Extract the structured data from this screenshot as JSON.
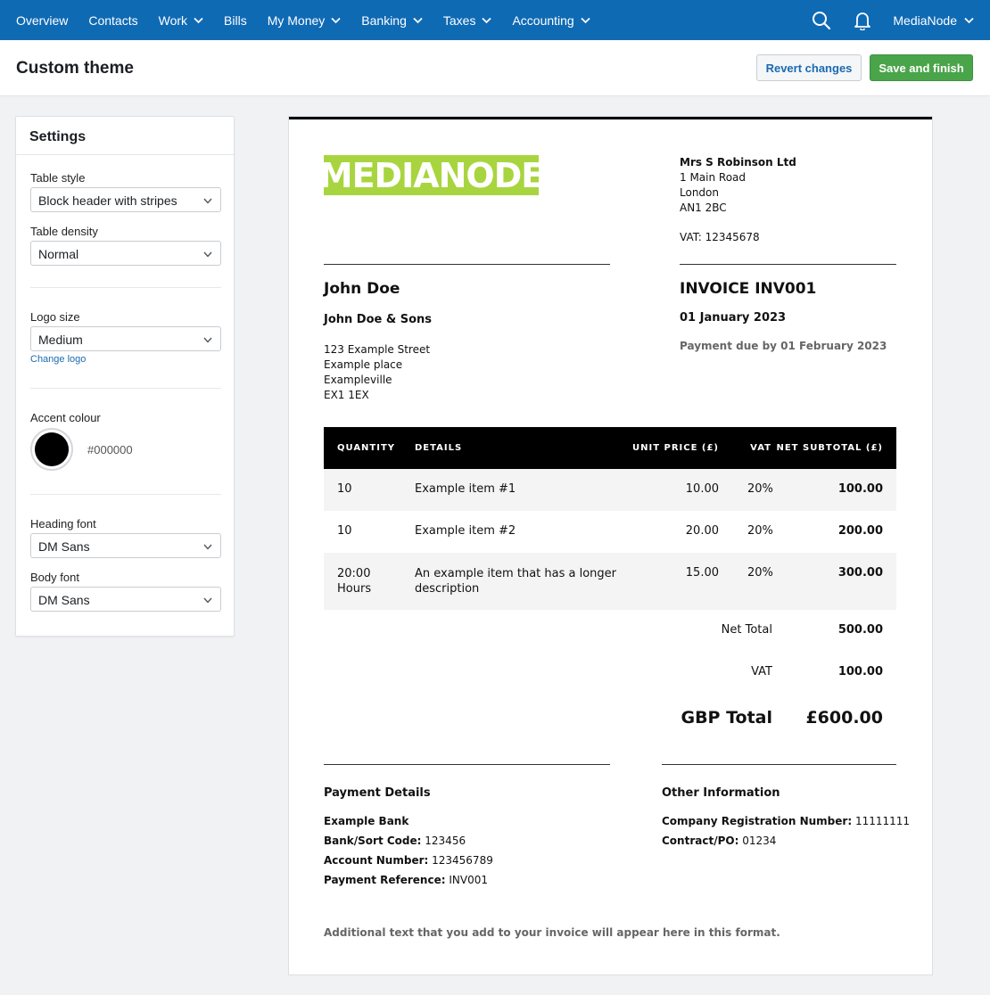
{
  "nav": {
    "items": [
      {
        "label": "Overview",
        "dropdown": false
      },
      {
        "label": "Contacts",
        "dropdown": false
      },
      {
        "label": "Work",
        "dropdown": true
      },
      {
        "label": "Bills",
        "dropdown": false
      },
      {
        "label": "My Money",
        "dropdown": true
      },
      {
        "label": "Banking",
        "dropdown": true
      },
      {
        "label": "Taxes",
        "dropdown": true
      },
      {
        "label": "Accounting",
        "dropdown": true
      }
    ],
    "icons": [
      "search-icon",
      "bell-icon"
    ],
    "org_name": "MediaNode"
  },
  "page": {
    "title": "Custom theme",
    "revert_label": "Revert changes",
    "save_label": "Save and finish"
  },
  "settings": {
    "title": "Settings",
    "table_style_label": "Table style",
    "table_style_value": "Block header with stripes",
    "table_density_label": "Table density",
    "table_density_value": "Normal",
    "logo_size_label": "Logo size",
    "logo_size_value": "Medium",
    "change_logo_label": "Change logo",
    "accent_label": "Accent colour",
    "accent_hex": "#000000",
    "heading_font_label": "Heading font",
    "heading_font_value": "DM Sans",
    "body_font_label": "Body font",
    "body_font_value": "DM Sans"
  },
  "invoice": {
    "logo_text": "MEDIANODE",
    "logo_color": "#a8d53f",
    "sender": {
      "name": "Mrs S Robinson Ltd",
      "lines": [
        "1 Main Road",
        "London",
        "AN1 2BC"
      ],
      "vat": "VAT: 12345678"
    },
    "client": {
      "name": "John Doe",
      "company": "John Doe & Sons",
      "lines": [
        "123 Example Street",
        "Example place",
        "Exampleville",
        "EX1 1EX"
      ]
    },
    "number": "INVOICE INV001",
    "date": "01 January 2023",
    "due": "Payment due by 01 February 2023",
    "table": {
      "headers": [
        "QUANTITY",
        "DETAILS",
        "UNIT PRICE (£)",
        "VAT",
        "NET SUBTOTAL (£)"
      ],
      "rows": [
        {
          "qty": "10",
          "details": "Example item #1",
          "price": "10.00",
          "vat": "20%",
          "subtotal": "100.00"
        },
        {
          "qty": "10",
          "details": "Example item #2",
          "price": "20.00",
          "vat": "20%",
          "subtotal": "200.00"
        },
        {
          "qty": "20:00 Hours",
          "details": "An example item that has a longer description",
          "price": "15.00",
          "vat": "20%",
          "subtotal": "300.00"
        }
      ]
    },
    "totals": {
      "net_label": "Net Total",
      "net_value": "500.00",
      "vat_label": "VAT",
      "vat_value": "100.00",
      "gbp_label": "GBP Total",
      "gbp_value": "£600.00"
    },
    "payment": {
      "title": "Payment Details",
      "bank": "Example Bank",
      "sort_label": "Bank/Sort Code:",
      "sort_value": "123456",
      "acc_label": "Account Number:",
      "acc_value": "123456789",
      "ref_label": "Payment Reference:",
      "ref_value": "INV001"
    },
    "other": {
      "title": "Other Information",
      "reg_label": "Company Registration Number:",
      "reg_value": "11111111",
      "po_label": "Contract/PO:",
      "po_value": "01234"
    },
    "footer_text": "Additional text that you add to your invoice will appear here in this format."
  }
}
